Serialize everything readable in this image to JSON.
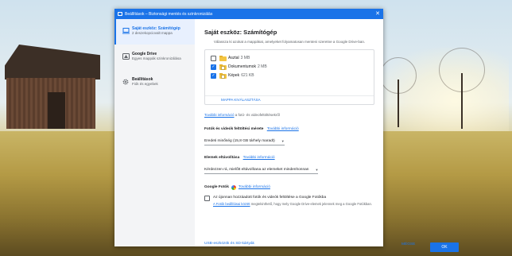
{
  "window": {
    "title": "Beállítások – Biztonsági mentés és szinkronizálás"
  },
  "sidebar": {
    "items": [
      {
        "title": "Saját eszköz: Számítógép",
        "subtitle": "2 deszekopciovalt mappa",
        "icon": "laptop-icon",
        "active": true
      },
      {
        "title": "Google Drive",
        "subtitle": "Egyes mappák szinkronizálása",
        "icon": "drive-icon",
        "active": false
      },
      {
        "title": "Beállítások",
        "subtitle": "Fiók és egyebek",
        "icon": "gear-icon",
        "active": false
      }
    ]
  },
  "main": {
    "heading": "Saját eszköz: Számítógép",
    "description": "Válassza ki azokat a mappákat, amelyeket folyamatosan menteni szeretne a Google Drive-ban.",
    "folders": [
      {
        "name": "Asztal",
        "size": "3 MB",
        "checked": false
      },
      {
        "name": "Dokumentumok",
        "size": "2 MB",
        "checked": true
      },
      {
        "name": "Képek",
        "size": "621 KB",
        "checked": true
      }
    ],
    "choose_folder": "MAPPA KIVÁLASZTÁSA",
    "photo_note_link": "További információ",
    "photo_note_text": "a fotó- és videofeltöltésekről",
    "upload_size": {
      "title": "Fotók és videók feltöltési mérete",
      "link": "További információ",
      "value": "Eredeti minőség (15,8 GB tárhely maradt)"
    },
    "deletion": {
      "title": "Elemek eltávolítása",
      "link": "További információ",
      "value": "Kérdezzen rá, mielőtt eltávolítana az elemeket mindenhonnan"
    },
    "google_photos": {
      "title": "Google Fotók",
      "link": "További információ",
      "checkbox_label": "Az újonnan hozzáadott fotók és videók feltöltése a Google Fotókba",
      "checkbox_checked": false,
      "note_link": "A Fotók beállításai között",
      "note_text": "megtekinthető, hogy mely Google Drive-elemek jelennek meg a Google Fotókban."
    }
  },
  "footer": {
    "usb_link": "USB-eszközök és SD-kártyák",
    "cancel": "MÉGSE",
    "ok": "OK"
  },
  "colors": {
    "accent": "#1a73e8",
    "titlebar": "#1a73e8"
  }
}
